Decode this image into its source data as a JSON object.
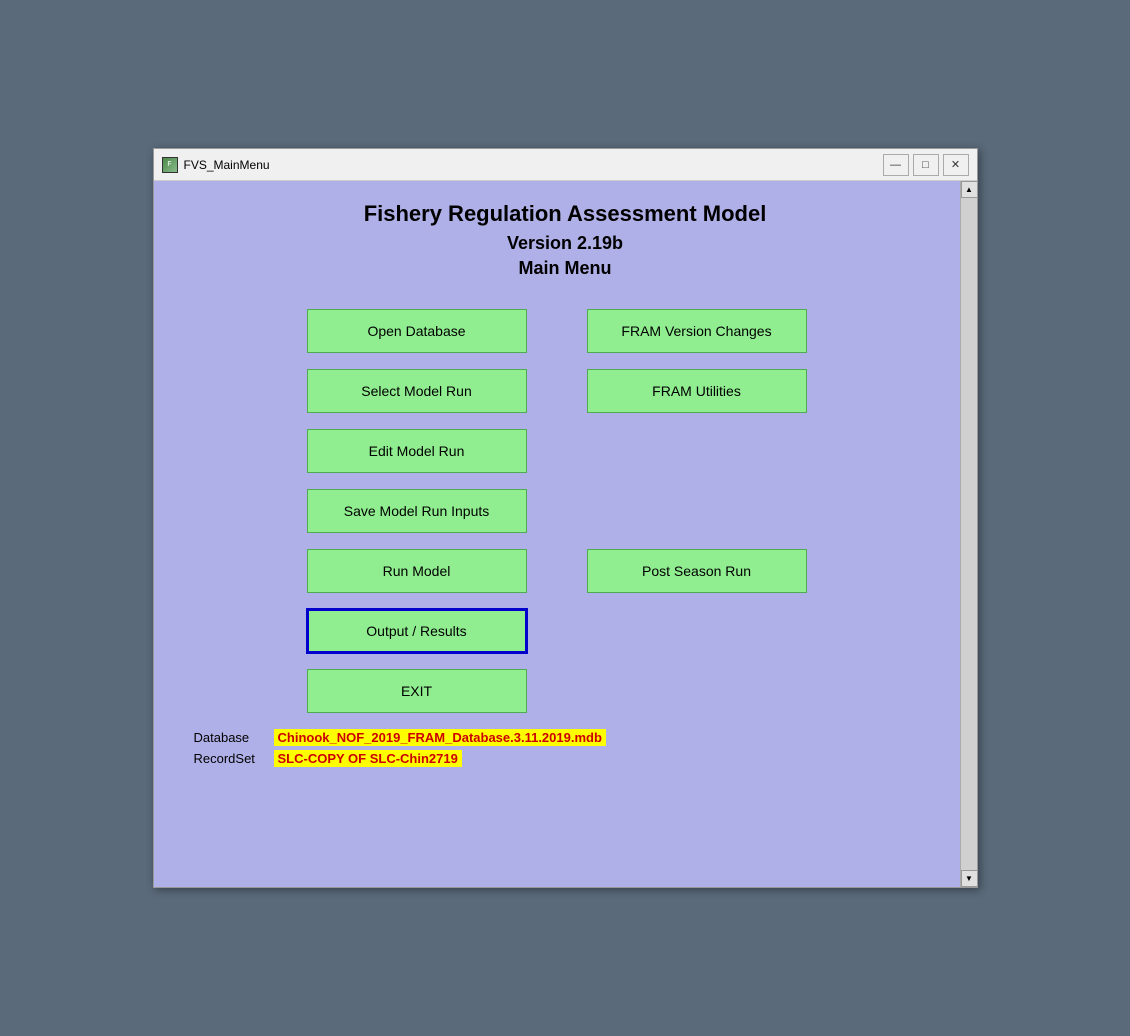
{
  "window": {
    "title": "FVS_MainMenu",
    "icon_label": "FVS"
  },
  "titlebar": {
    "minimize_label": "—",
    "maximize_label": "□",
    "close_label": "✕"
  },
  "header": {
    "title": "Fishery Regulation Assessment Model",
    "version": "Version 2.19b",
    "menu_title": "Main Menu"
  },
  "buttons": {
    "open_database": "Open Database",
    "fram_version_changes": "FRAM Version Changes",
    "select_model_run": "Select Model Run",
    "fram_utilities": "FRAM Utilities",
    "edit_model_run": "Edit Model Run",
    "save_model_run": "Save Model Run Inputs",
    "run_model": "Run Model",
    "post_season_run": "Post Season Run",
    "output_results": "Output / Results",
    "exit": "EXIT"
  },
  "footer": {
    "database_label": "Database",
    "database_value": "Chinook_NOF_2019_FRAM_Database.3.11.2019.mdb",
    "recordset_label": "RecordSet",
    "recordset_value": "SLC-COPY OF SLC-Chin2719"
  },
  "scrollbar": {
    "up_arrow": "▲",
    "down_arrow": "▼"
  }
}
